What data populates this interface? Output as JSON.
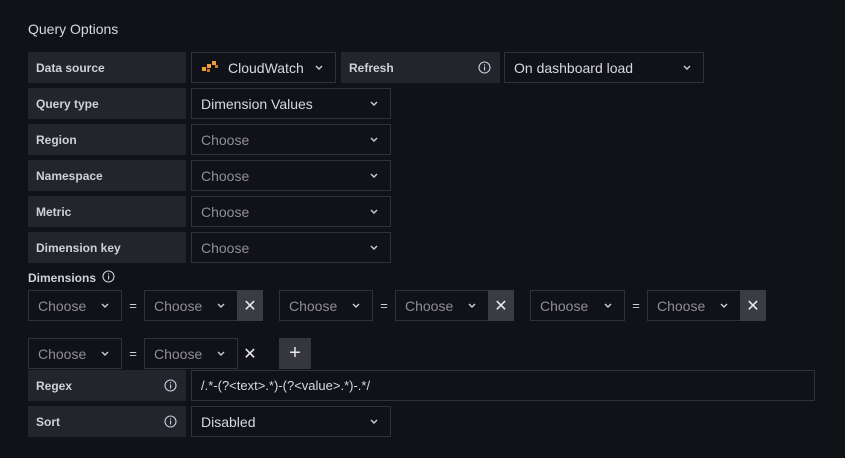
{
  "section_title": "Query Options",
  "datasource": {
    "label": "Data source",
    "value": "CloudWatch",
    "icon": "cloudwatch-icon"
  },
  "refresh": {
    "label": "Refresh",
    "value": "On dashboard load"
  },
  "query_type": {
    "label": "Query type",
    "value": "Dimension Values"
  },
  "region": {
    "label": "Region",
    "placeholder": "Choose"
  },
  "namespace": {
    "label": "Namespace",
    "placeholder": "Choose"
  },
  "metric": {
    "label": "Metric",
    "placeholder": "Choose"
  },
  "dimension_key": {
    "label": "Dimension key",
    "placeholder": "Choose"
  },
  "dimensions": {
    "label": "Dimensions",
    "filters": [
      {
        "key": "Choose",
        "op": "=",
        "value": "Choose"
      },
      {
        "key": "Choose",
        "op": "=",
        "value": "Choose"
      },
      {
        "key": "Choose",
        "op": "=",
        "value": "Choose"
      },
      {
        "key": "Choose",
        "op": "=",
        "value": "Choose"
      }
    ],
    "remove_symbol": "✕",
    "add_symbol": "+"
  },
  "regex": {
    "label": "Regex",
    "value": "/.*-(?<text>.*)-(?<value>.*)-.*/"
  },
  "sort": {
    "label": "Sort",
    "value": "Disabled"
  },
  "colors": {
    "background": "#111217",
    "label_bg": "#22252b",
    "border": "#2f3238",
    "aws_orange": "#f19e39"
  }
}
